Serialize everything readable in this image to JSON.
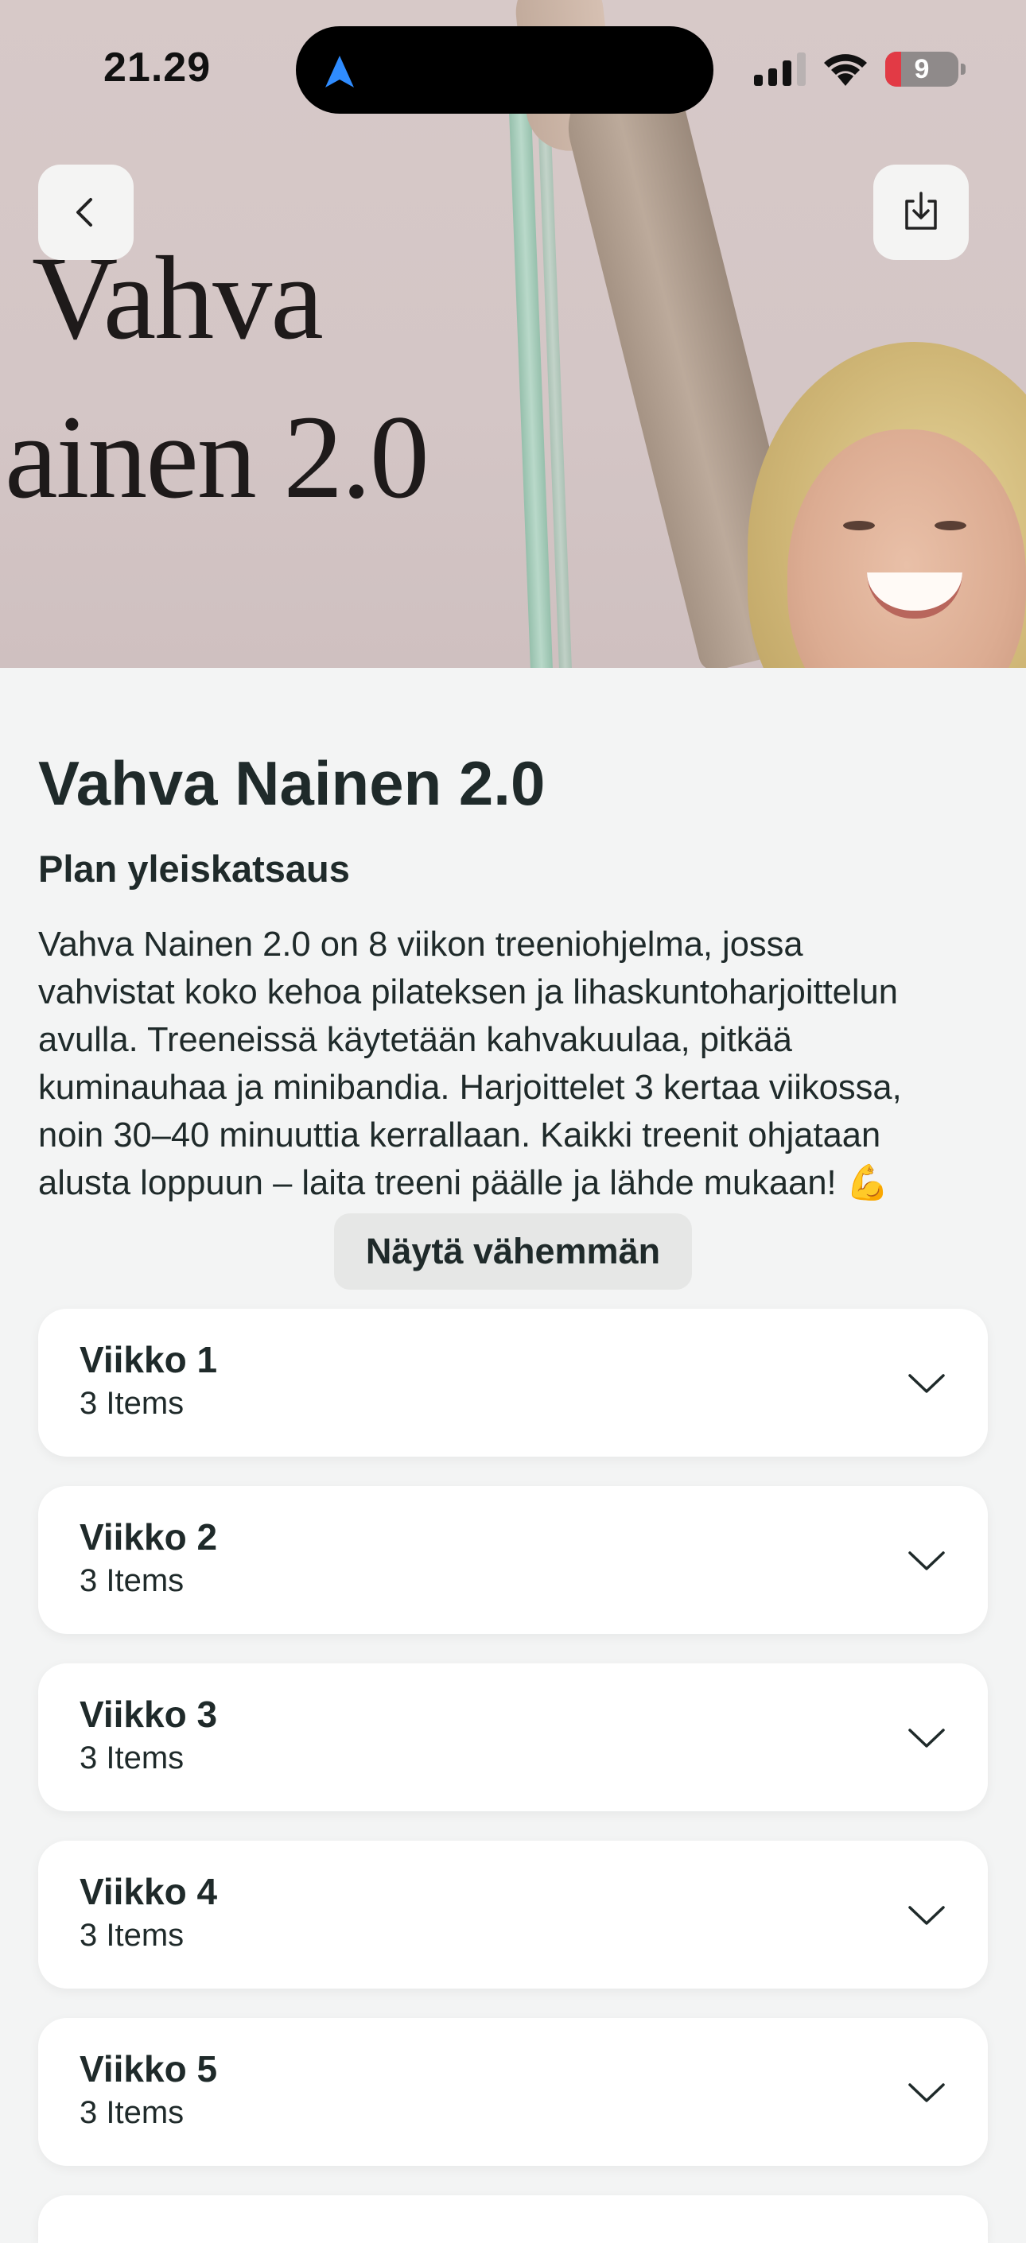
{
  "status_bar": {
    "time": "21.29",
    "battery_level": "9"
  },
  "hero": {
    "title_line1": "Vahva",
    "title_line2": "ainen 2.0"
  },
  "toolbar": {
    "back_icon": "chevron-left-icon",
    "download_icon": "download-icon"
  },
  "plan": {
    "title": "Vahva Nainen 2.0",
    "overview_heading": "Plan yleiskatsaus",
    "description_lines": [
      "Vahva Nainen 2.0 on 8 viikon treeniohjelma, jossa",
      "vahvistat koko kehoa pilateksen ja lihaskuntoharjoittelun",
      "avulla. Treeneissä käytetään kahvakuulaa, pitkää",
      "kuminauhaa ja minibandia. Harjoittelet 3 kertaa viikossa,",
      "noin 30–40 minuuttia kerrallaan. Kaikki treenit ohjataan",
      "alusta loppuun – laita treeni päälle ja lähde mukaan! 💪"
    ],
    "toggle_label": "Näytä vähemmän"
  },
  "weeks": [
    {
      "name": "Viikko 1",
      "count": "3 Items"
    },
    {
      "name": "Viikko 2",
      "count": "3 Items"
    },
    {
      "name": "Viikko 3",
      "count": "3 Items"
    },
    {
      "name": "Viikko 4",
      "count": "3 Items"
    },
    {
      "name": "Viikko 5",
      "count": "3 Items"
    }
  ],
  "colors": {
    "background": "#f3f4f4",
    "text": "#1f2a2a",
    "card": "#ffffff",
    "button": "#e6e7e6",
    "location_arrow": "#2f8cff"
  }
}
